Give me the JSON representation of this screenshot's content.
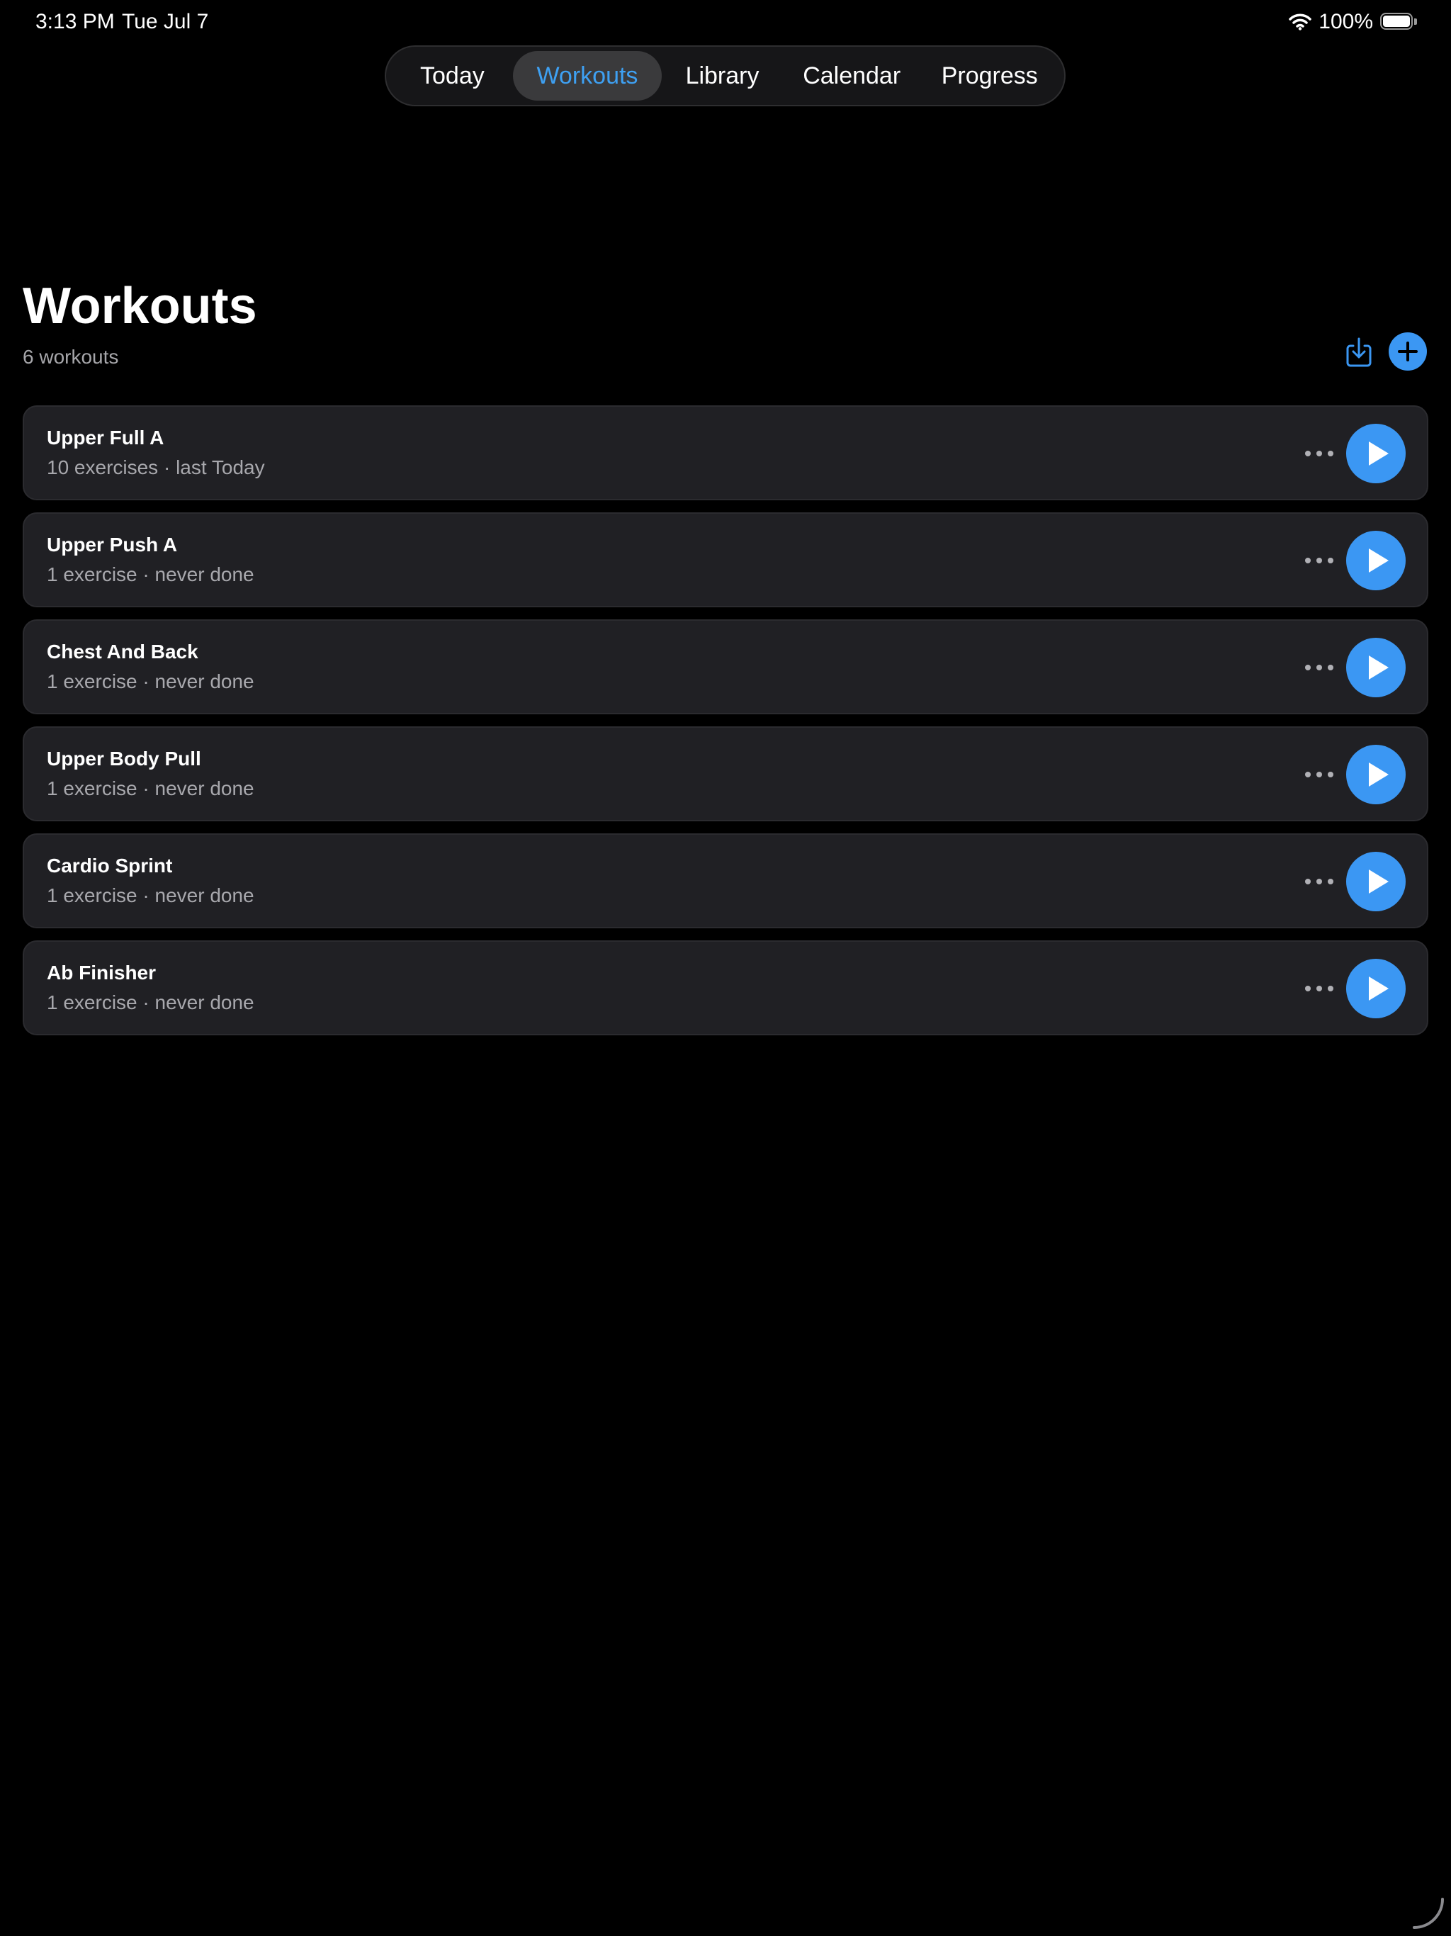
{
  "status_bar": {
    "time": "3:13 PM",
    "date": "Tue Jul 7",
    "battery_percent": "100%",
    "wifi_icon": "wifi-icon",
    "battery_icon": "battery-full-icon",
    "battery_level": 1.0
  },
  "tabs": [
    {
      "label": "Today",
      "active": false
    },
    {
      "label": "Workouts",
      "active": true
    },
    {
      "label": "Library",
      "active": false
    },
    {
      "label": "Calendar",
      "active": false
    },
    {
      "label": "Progress",
      "active": false
    }
  ],
  "header": {
    "title": "Workouts",
    "subtitle": "6 workouts",
    "import_icon": "import-icon",
    "add_icon": "plus-icon"
  },
  "workouts": [
    {
      "name": "Upper Full A",
      "meta": "10 exercises · last Today"
    },
    {
      "name": "Upper Push A",
      "meta": "1 exercise · never done"
    },
    {
      "name": "Chest And Back",
      "meta": "1 exercise · never done"
    },
    {
      "name": "Upper Body Pull",
      "meta": "1 exercise · never done"
    },
    {
      "name": "Cardio Sprint",
      "meta": "1 exercise · never done"
    },
    {
      "name": "Ab Finisher",
      "meta": "1 exercise · never done"
    }
  ],
  "colors": {
    "accent": "#3b97f3",
    "active_tab_text": "#3ea0f2",
    "background": "#000000",
    "card": "#202024",
    "secondary_text": "#a8a8ad"
  }
}
